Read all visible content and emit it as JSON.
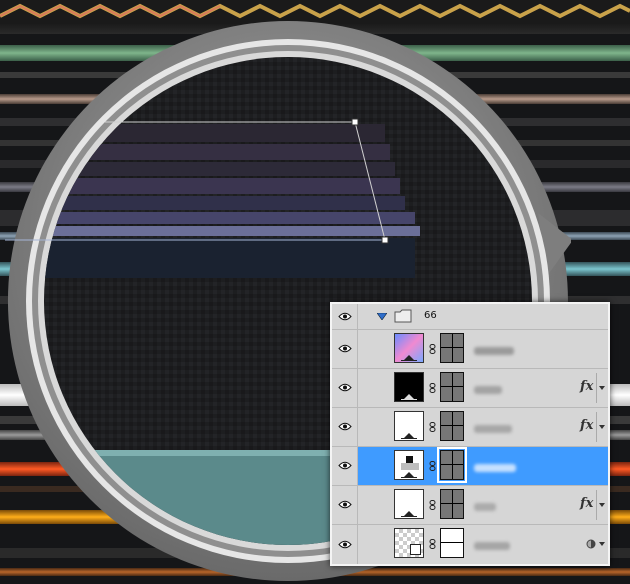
{
  "colors": {
    "panel_bg": "#d6d6d6",
    "selection": "#3f9bff",
    "ring_outer": "#8a8a8a",
    "ring_inner": "#cfcfcf",
    "canvas_dark": "#1c1c1e",
    "teal_band": "#5d8e8f"
  },
  "layers_panel": {
    "group": {
      "name": "66",
      "expanded": true,
      "icons": [
        "eye-icon",
        "disclosure-triangle-icon",
        "folder-icon"
      ]
    },
    "layers": [
      {
        "id": "layer-1",
        "thumb": "gradient-pink-blue",
        "has_mask": true,
        "fx": false,
        "selected": false
      },
      {
        "id": "layer-2",
        "thumb": "black",
        "has_mask": true,
        "fx": true,
        "selected": false
      },
      {
        "id": "layer-3",
        "thumb": "white",
        "has_mask": true,
        "fx": true,
        "selected": false
      },
      {
        "id": "layer-4",
        "thumb": "white-with-black-square",
        "has_mask": true,
        "fx": false,
        "selected": true
      },
      {
        "id": "layer-5",
        "thumb": "white",
        "has_mask": true,
        "fx": true,
        "selected": false
      },
      {
        "id": "layer-6",
        "thumb": "transparent-smart-object",
        "has_mask": true,
        "fx": false,
        "selected": false,
        "extra_icon": "adjustment-icon"
      }
    ],
    "fx_label": "fx"
  }
}
